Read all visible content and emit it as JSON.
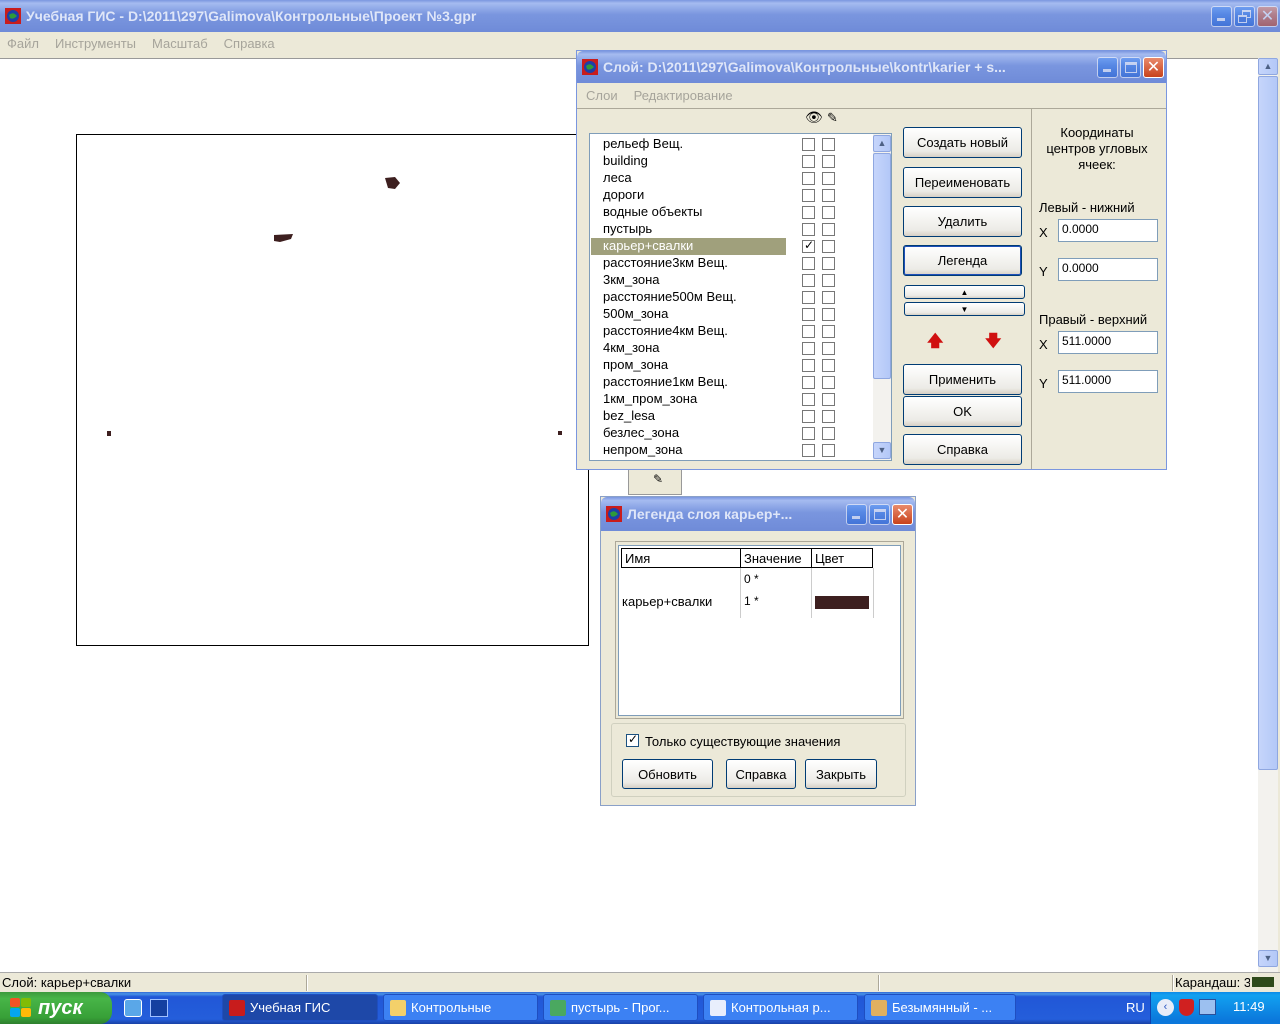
{
  "main": {
    "title": "Учебная ГИС - D:\\2011\\297\\Galimova\\Контрольные\\Проект №3.gpr",
    "menu": [
      "Файл",
      "Инструменты",
      "Масштаб",
      "Справка"
    ],
    "status_left": "Слой: карьер+свалки",
    "status_right": "Карандаш: 3"
  },
  "layers_dialog": {
    "title": "Слой: D:\\2011\\297\\Galimova\\Контрольные\\kontr\\karier + s...",
    "menu": [
      "Слои",
      "Редактирование"
    ],
    "layers": [
      {
        "name": "рельеф Вещ.",
        "visible": false
      },
      {
        "name": "building",
        "visible": false
      },
      {
        "name": "леса",
        "visible": false
      },
      {
        "name": "дороги",
        "visible": false
      },
      {
        "name": "водные объекты",
        "visible": false
      },
      {
        "name": "пустырь",
        "visible": false
      },
      {
        "name": "карьер+свалки",
        "visible": true,
        "selected": true
      },
      {
        "name": "расстояние3км Вещ.",
        "visible": false
      },
      {
        "name": "3км_зона",
        "visible": false
      },
      {
        "name": "расстояние500м Вещ.",
        "visible": false
      },
      {
        "name": "500м_зона",
        "visible": false
      },
      {
        "name": "расстояние4км Вещ.",
        "visible": false
      },
      {
        "name": "4км_зона",
        "visible": false
      },
      {
        "name": "пром_зона",
        "visible": false
      },
      {
        "name": "расстояние1км Вещ.",
        "visible": false
      },
      {
        "name": "1км_пром_зона",
        "visible": false
      },
      {
        "name": "bez_lesa",
        "visible": false
      },
      {
        "name": "безлес_зона",
        "visible": false
      },
      {
        "name": "непром_зона",
        "visible": false
      }
    ],
    "buttons": {
      "create": "Создать новый",
      "rename": "Переименовать",
      "delete": "Удалить",
      "legend": "Легенда",
      "apply": "Применить",
      "ok": "OK",
      "help": "Справка"
    },
    "coords": {
      "title": "Координаты центров угловых ячеек:",
      "lower_left": "Левый - нижний",
      "upper_right": "Правый - верхний",
      "x_label": "X",
      "y_label": "Y",
      "ll_x": "0.0000",
      "ll_y": "0.0000",
      "ur_x": "511.0000",
      "ur_y": "511.0000"
    }
  },
  "legend_dialog": {
    "title": "Легенда слоя карьер+...",
    "columns": [
      "Имя",
      "Значение",
      "Цвет"
    ],
    "rows": [
      {
        "name": "",
        "value": "0 *",
        "color": ""
      },
      {
        "name": "карьер+свалки",
        "value": "1 *",
        "color": "#3d1f1f"
      }
    ],
    "only_existing_label": "Только существующие значения",
    "only_existing_checked": true,
    "buttons": {
      "refresh": "Обновить",
      "help": "Справка",
      "close": "Закрыть"
    }
  },
  "taskbar": {
    "start_label": "пуск",
    "tasks": [
      "Учебная ГИС",
      "Контрольные",
      "пустырь - Прог...",
      "Контрольная р...",
      "Безымянный - ..."
    ],
    "lang": "RU",
    "clock": "11:49"
  },
  "colors": {
    "feature": "#3d1f1f",
    "selection": "#a0a07c"
  }
}
